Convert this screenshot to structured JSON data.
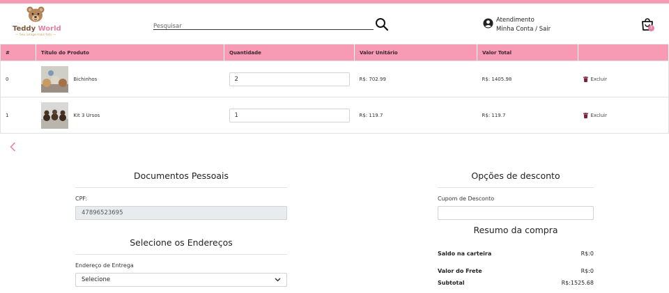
{
  "brand": {
    "name_part1": "Teddy",
    "name_part2": "World",
    "tagline": "Seu amigo mais fofo"
  },
  "search": {
    "placeholder": "Pesquisar"
  },
  "account": {
    "line1": "Atendimento",
    "line2": "Minha Conta / Sair"
  },
  "cart": {
    "badge": "2"
  },
  "table": {
    "headers": [
      "#",
      "Título do Produto",
      "Quantidade",
      "Valor Unitário",
      "Valor Total",
      ""
    ],
    "rows": [
      {
        "index": "0",
        "title": "Bichinhos",
        "quantity": "2",
        "unit_price": "R$: 702.99",
        "total": "R$: 1405.98",
        "delete_label": "Excluir"
      },
      {
        "index": "1",
        "title": "Kit 3 Ursos",
        "quantity": "1",
        "unit_price": "R$: 119.7",
        "total": "R$: 119.7",
        "delete_label": "Excluir"
      }
    ]
  },
  "documents": {
    "title": "Documentos Pessoais",
    "cpf_label": "CPF:",
    "cpf_value": "47896523695"
  },
  "addresses": {
    "title": "Selecione os Endereços",
    "delivery_label": "Endereço de Entrega",
    "delivery_value": "Selecione"
  },
  "discount": {
    "title": "Opções de desconto",
    "coupon_label": "Cupom de Desconto",
    "coupon_value": ""
  },
  "summary": {
    "title": "Resumo da compra",
    "wallet_label": "Saldo na carteira",
    "wallet_value": "R$:0",
    "shipping_label": "Valor do Frete",
    "shipping_value": "R$:0",
    "subtotal_label": "Subtotal",
    "subtotal_value": "R$:1525.68"
  },
  "colors": {
    "accent_pink": "#f79bb4",
    "badge_pink": "#e97fa0",
    "delete_icon": "#7a1f3a"
  },
  "icons": [
    "teddy-bear-logo",
    "search-icon",
    "user-circle-icon",
    "shopping-bag-icon",
    "trash-icon",
    "chevron-left-icon"
  ]
}
